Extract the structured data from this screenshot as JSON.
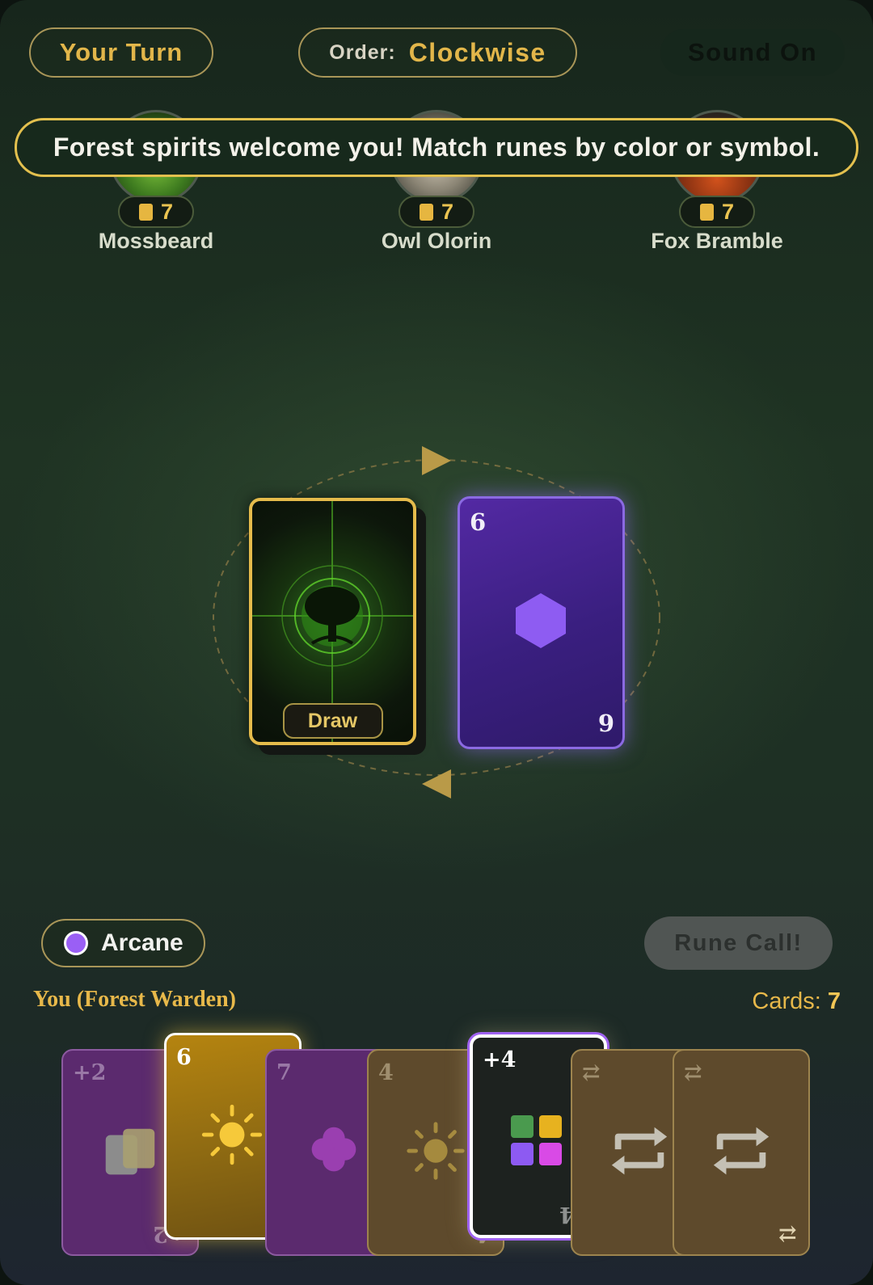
{
  "header": {
    "turn_label": "Your Turn",
    "order_label": "Order:",
    "order_value": "Clockwise",
    "sound_label": "Sound On"
  },
  "banner": {
    "message": "Forest spirits welcome you! Match runes by color or symbol."
  },
  "players": [
    {
      "name": "Mossbeard",
      "cards": "7",
      "avatar": "moss-spirit"
    },
    {
      "name": "Owl Olorin",
      "cards": "7",
      "avatar": "owl"
    },
    {
      "name": "Fox Bramble",
      "cards": "7",
      "avatar": "fox"
    }
  ],
  "table": {
    "draw_label": "Draw",
    "discard": {
      "top_value": "6",
      "bottom_value": "9",
      "color": "#4a2690",
      "symbol": "hexagon-icon"
    }
  },
  "current_color": {
    "name": "Arcane",
    "hex": "#9a5ff5"
  },
  "rune_call_label": "Rune Call!",
  "you": {
    "label": "You (Forest Warden)",
    "cards_prefix": "Cards:",
    "cards_count": "7"
  },
  "hand": [
    {
      "top": "+2",
      "bottom": "+2",
      "color": "purple",
      "symbol": "draw-two-icon"
    },
    {
      "top": "6",
      "bottom": "9",
      "color": "gold",
      "symbol": "sun-icon"
    },
    {
      "top": "7",
      "bottom": "9",
      "color": "purple",
      "symbol": "clover-icon"
    },
    {
      "top": "4",
      "bottom": "4",
      "color": "brown",
      "symbol": "sun-icon"
    },
    {
      "top": "+4",
      "bottom": "+4",
      "color": "wild",
      "symbol": "wild-four-colors-icon"
    },
    {
      "top": "⇄",
      "bottom": "⇄",
      "color": "brown",
      "symbol": "reverse-icon"
    },
    {
      "top": "⇄",
      "bottom": "⇄",
      "color": "brown",
      "symbol": "reverse-icon"
    }
  ],
  "colors": {
    "accent_gold": "#e2b64a",
    "arcane_purple": "#9a5ff5",
    "banner_border": "#e3c04e"
  }
}
